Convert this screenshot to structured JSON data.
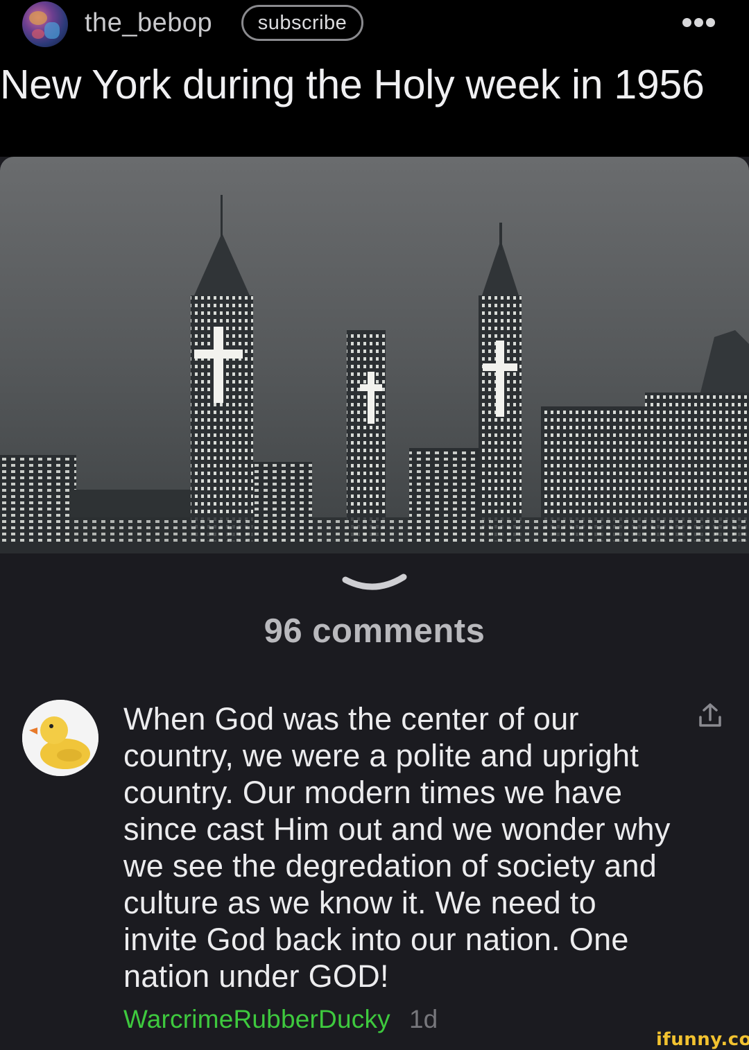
{
  "header": {
    "channel_name": "the_bebop",
    "subscribe_label": "subscribe",
    "more_icon": "more-horizontal-icon"
  },
  "post": {
    "title": "New York during the Holy week in 1956",
    "image": "city skyline at night with illuminated crosses"
  },
  "comments_section": {
    "count_label": "96 comments",
    "collapse_icon": "chevron-down-icon"
  },
  "comment": {
    "avatar": "rubber-duck-avatar",
    "text": "When God was the center of our country, we were a polite and upright country. Our modern times we have since cast Him out and we wonder why we see the degredation of society and culture as we know it. We need to invite God back into our nation. One nation under GOD!",
    "author": "WarcrimeRubberDucky",
    "time": "1d",
    "share_icon": "share-icon"
  },
  "watermark": "ifunny.co",
  "colors": {
    "background": "#1b1b20",
    "author": "#3ec93e",
    "watermark": "#f2c230"
  }
}
